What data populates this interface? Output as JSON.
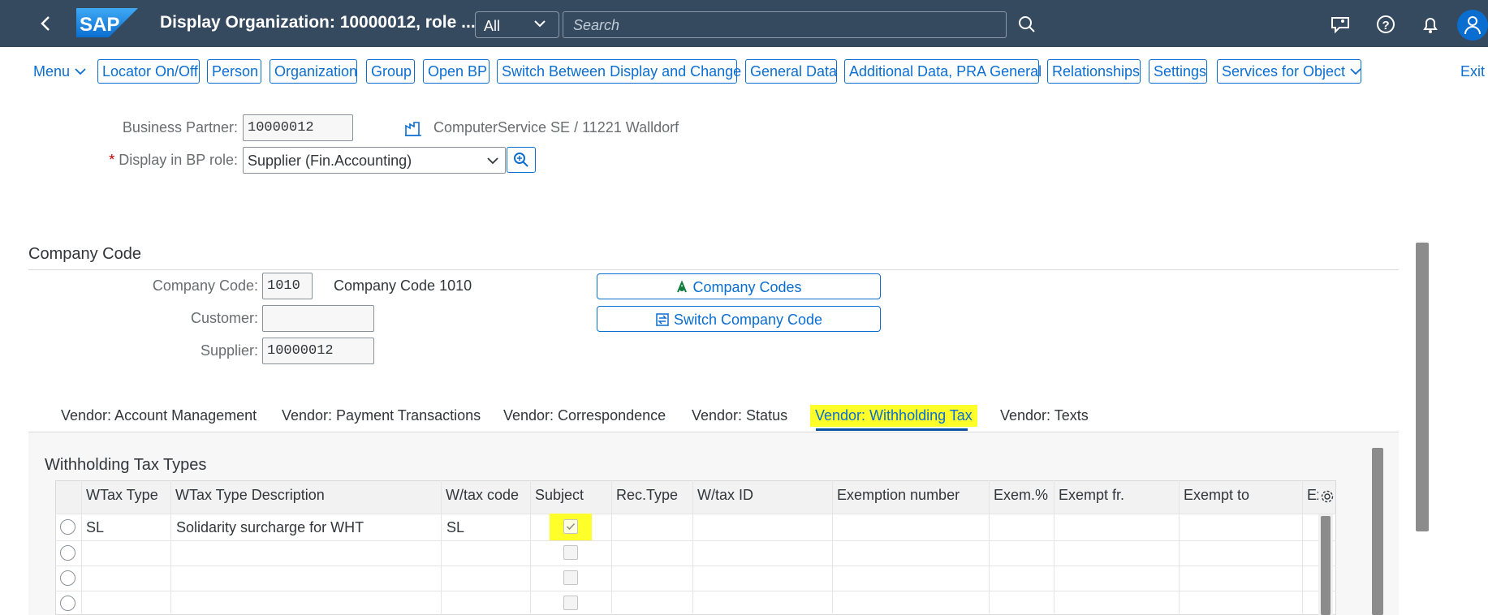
{
  "shell": {
    "title": "Display Organization: 10000012, role ...",
    "scope": "All",
    "search_placeholder": "Search",
    "logo_text": "SAP"
  },
  "toolbar": {
    "menu": "Menu",
    "buttons": [
      "Locator On/Off",
      "Person",
      "Organization",
      "Group",
      "Open BP",
      "Switch Between Display and Change",
      "General Data",
      "Additional Data, PRA General",
      "Relationships",
      "Settings",
      "Services for Object"
    ],
    "exit": "Exit"
  },
  "header": {
    "bp_label": "Business Partner:",
    "bp_value": "10000012",
    "bp_description": "ComputerService SE / 11221 Walldorf",
    "role_required": "*",
    "role_label": "Display in BP role:",
    "role_value": "Supplier (Fin.Accounting)"
  },
  "company_code": {
    "title": "Company Code",
    "cc_label": "Company Code:",
    "cc_value": "1010",
    "cc_name": "Company Code 1010",
    "customer_label": "Customer:",
    "customer_value": "",
    "supplier_label": "Supplier:",
    "supplier_value": "10000012",
    "btn_company_codes": "Company Codes",
    "btn_switch": "Switch Company Code"
  },
  "tabs": [
    "Vendor: Account Management",
    "Vendor: Payment Transactions",
    "Vendor: Correspondence",
    "Vendor: Status",
    "Vendor: Withholding Tax",
    "Vendor: Texts"
  ],
  "active_tab": "Vendor: Withholding Tax",
  "wht": {
    "title": "Withholding Tax Types",
    "columns": [
      "WTax Type",
      "WTax Type Description",
      "W/tax code",
      "Subject",
      "Rec.Type",
      "W/tax ID",
      "Exemption number",
      "Exem.%",
      "Exempt fr.",
      "Exempt to",
      "Ex"
    ],
    "rows": [
      {
        "wtax_type": "SL",
        "description": "Solidarity surcharge for WHT",
        "wtax_code": "SL",
        "subject": true
      },
      {
        "wtax_type": "",
        "description": "",
        "wtax_code": "",
        "subject": false
      },
      {
        "wtax_type": "",
        "description": "",
        "wtax_code": "",
        "subject": false
      },
      {
        "wtax_type": "",
        "description": "",
        "wtax_code": "",
        "subject": false
      }
    ]
  },
  "colors": {
    "shell_bg": "#354a5f",
    "accent": "#0a6ed1",
    "highlight": "#ffff29",
    "required": "#bb0000"
  }
}
